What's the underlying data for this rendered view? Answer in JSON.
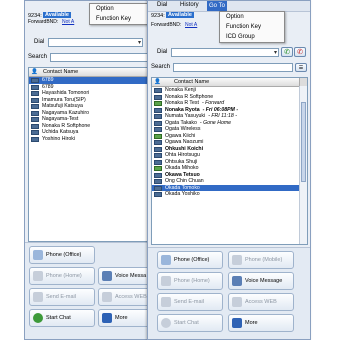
{
  "back_window": {
    "user_id": "9234:",
    "status": "Available",
    "forward_label": "ForwardBND:",
    "forward_link": "Not A",
    "dial_label": "Dial",
    "search_label": "Search",
    "menu": {
      "items": [
        "Option",
        "Function Key"
      ]
    },
    "list_header": "Contact Name",
    "contacts": [
      "6789",
      "6789",
      "Hayashida Tomonori",
      "Imamura Toru(SIP)",
      "Matsufuji Katsuya",
      "Nagayama Kazuhiro",
      "Nagayama-Test",
      "Nonaka R Softphone",
      "Uchida Katsuya",
      "Yoshino Hiroki"
    ],
    "actions": {
      "phone_office": "Phone (Office)",
      "phone_home": "Phone (Home)",
      "voice_message": "Voice Messa",
      "send_email": "Send E-mail",
      "access_web": "Access WEB",
      "start_chat": "Start Chat",
      "more": "More"
    }
  },
  "front_window": {
    "user_id": "9234:",
    "status": "Available",
    "forward_label": "ForwardBND:",
    "forward_link": "Not A",
    "menubar": [
      "Dial",
      "History",
      "Go To"
    ],
    "menu": {
      "items": [
        "Option",
        "Function Key",
        "ICD Group"
      ]
    },
    "dial_label": "Dial",
    "search_label": "Search",
    "list_header": "Contact Name",
    "contacts": [
      {
        "name": "Nonaka Kenji"
      },
      {
        "name": "Nonaka R Softphone"
      },
      {
        "name": "Nonaka R Test",
        "note": "- Forward"
      },
      {
        "name": "Nonaka Ryota",
        "note": "- Fri 06:08PM -",
        "bold": true
      },
      {
        "name": "Numata Yasuyuki",
        "note": "- FRI 11:18 -"
      },
      {
        "name": "Ogata Takako",
        "note": "- Gone Home"
      },
      {
        "name": "Ogata Wireless"
      },
      {
        "name": "Ogawa Kiichi"
      },
      {
        "name": "Ogawa Naozumi"
      },
      {
        "name": "Ohkushi Koichi",
        "bold": true
      },
      {
        "name": "Ohta Hirotsugu"
      },
      {
        "name": "Ohtsuka Shuji"
      },
      {
        "name": "Okada Mihoko"
      },
      {
        "name": "Okawa Tetsuo",
        "bold": true
      },
      {
        "name": "Ong Chin Chuan"
      },
      {
        "name": "Okada Tomoko",
        "selected": true
      },
      {
        "name": "Okada Yoshiko"
      }
    ],
    "actions": {
      "phone_office": "Phone (Office)",
      "phone_mobile": "Phone (Mobile)",
      "phone_home": "Phone (Home)",
      "voice_message": "Voice Message",
      "send_email": "Send E-mail",
      "access_web": "Access WEB",
      "start_chat": "Start Chat",
      "more": "More"
    }
  },
  "colors": {
    "selection": "#316ac5",
    "accent": "#2a6fcd"
  }
}
